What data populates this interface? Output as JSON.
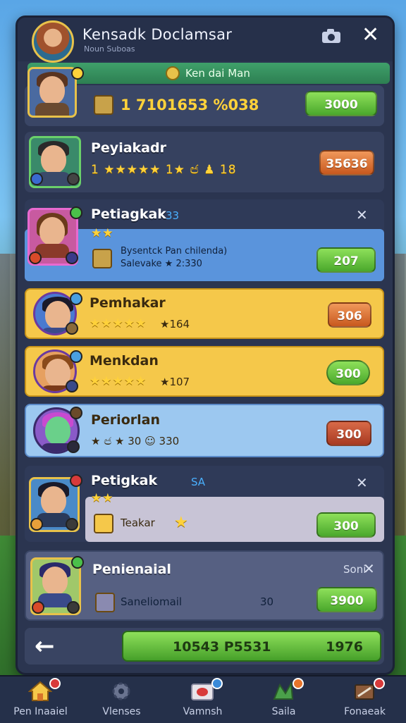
{
  "header": {
    "title": "Kensadk Doclamsar",
    "subtitle": "Noun Suboas"
  },
  "banner": {
    "text": "Ken dai Man"
  },
  "top_row": {
    "value": "1 7101653 %038",
    "button": "3000"
  },
  "rows": [
    {
      "name": "Peyiakadr",
      "stat": "1  ★★★★★ 1★  ඦ  ♟ 18",
      "button": "35636"
    },
    {
      "name": "Petiagkak",
      "badge_text": "33",
      "item_line1": "Bysentck Pan chilenda)",
      "item_line2": "Salevake ★ 2:330",
      "button": "207"
    },
    {
      "name": "Pemhakar",
      "stat": "★164",
      "button": "306"
    },
    {
      "name": "Menkdan",
      "stat": "★107",
      "button": "300"
    },
    {
      "name": "Periorlan",
      "stat": "★ ඦ ★ 30  ☺ 330",
      "button": "300"
    },
    {
      "name": "Petigkak",
      "badge_text": "SA",
      "item_label": "Teakar",
      "button": "300"
    },
    {
      "name": "Penienaial",
      "corner_label": "Soni",
      "item_label": "Saneliomail",
      "stat": "30",
      "button": "3900"
    }
  ],
  "bottom": {
    "total": "10543 P5531",
    "side": "1976"
  },
  "nav": [
    {
      "label": "Pen Inaaiel",
      "icon": "home-icon"
    },
    {
      "label": "Vlenses",
      "icon": "gear-icon"
    },
    {
      "label": "Vamnsh",
      "icon": "mail-icon"
    },
    {
      "label": "Saila",
      "icon": "map-icon"
    },
    {
      "label": "Fonaeak",
      "icon": "book-icon"
    }
  ],
  "colors": {
    "panel": "#2b3550",
    "gold": "#e8c24a",
    "green": "#4aa82c",
    "yellow_row": "#f5c84a",
    "blue_row": "#7cb8ee"
  }
}
